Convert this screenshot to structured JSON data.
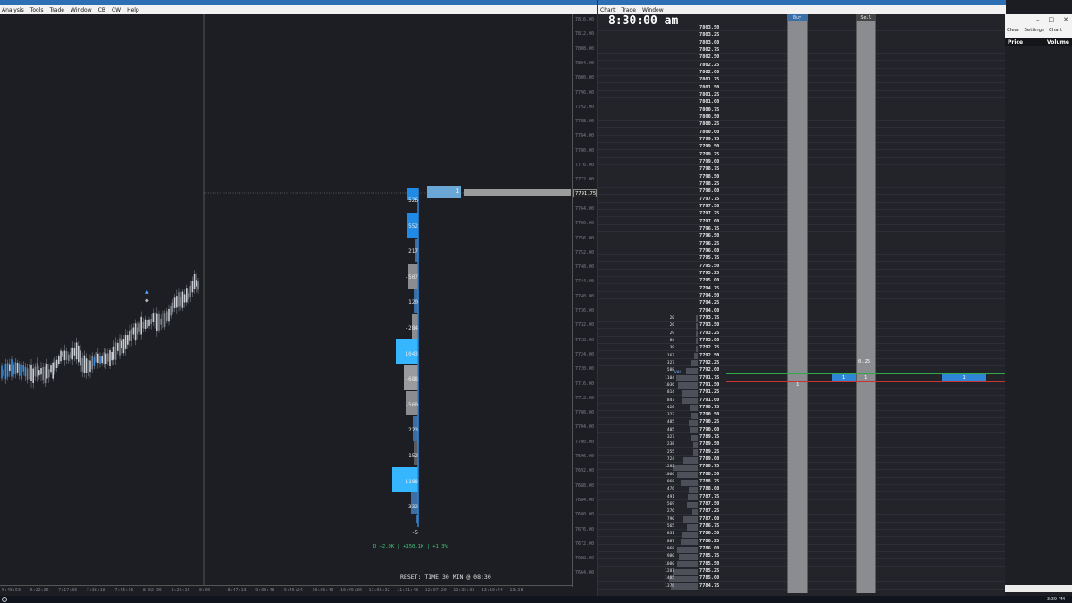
{
  "left_window": {
    "menu": [
      "Analysis",
      "Tools",
      "Trade",
      "Window",
      "CB",
      "CW",
      "Help"
    ],
    "price_axis_ticks": [
      "7816.00",
      "7812.00",
      "7808.00",
      "7804.00",
      "7800.00",
      "7796.00",
      "7792.00",
      "7788.00",
      "7784.00",
      "7780.00",
      "7776.00",
      "7772.00",
      "7768.00",
      "7764.00",
      "7760.00",
      "7756.00",
      "7752.00",
      "7748.00",
      "7744.00",
      "7740.00",
      "7736.00",
      "7732.00",
      "7728.00",
      "7724.00",
      "7720.00",
      "7716.00",
      "7712.00",
      "7708.00",
      "7704.00",
      "7700.00",
      "7696.00",
      "7692.00",
      "7688.00",
      "7684.00",
      "7680.00",
      "7676.00",
      "7672.00",
      "7668.00",
      "7664.00"
    ],
    "last_price": "7791.75",
    "time_axis_ticks": [
      "5:45:53",
      "6:22:26",
      "7:17:36",
      "7:38:18",
      "7:45:16",
      "8:02:35",
      "8:22:14",
      "8:30",
      "8:47:13",
      "9:03:48",
      "9:45:24",
      "10:06:40",
      "10:45:30",
      "11:08:32",
      "11:31:48",
      "12:07:20",
      "12:35:32",
      "13:10:44",
      "13:28"
    ],
    "delta_labels": [
      "526",
      "552",
      "217",
      "-507",
      "120",
      "-284",
      "1043",
      "-688",
      "-560",
      "223",
      "-152",
      "1188",
      "332",
      "-5"
    ],
    "summary": "D +2.0K | +150.1K | +1.3%",
    "reset_text": "RESET: TIME 30 MIN @ 08:30",
    "order_qty": "1"
  },
  "right_window": {
    "menu": [
      "Chart",
      "Trade",
      "Window"
    ],
    "clock": "8:30:00 am",
    "buy_header": "Buy",
    "sell_header": "Sell",
    "prices": [
      "7803.50",
      "7803.25",
      "7803.00",
      "7802.75",
      "7802.50",
      "7802.25",
      "7802.00",
      "7801.75",
      "7801.50",
      "7801.25",
      "7801.00",
      "7800.75",
      "7800.50",
      "7800.25",
      "7800.00",
      "7799.75",
      "7799.50",
      "7799.25",
      "7799.00",
      "7798.75",
      "7798.50",
      "7798.25",
      "7798.00",
      "7797.75",
      "7797.50",
      "7797.25",
      "7797.00",
      "7796.75",
      "7796.50",
      "7796.25",
      "7796.00",
      "7795.75",
      "7795.50",
      "7795.25",
      "7795.00",
      "7794.75",
      "7794.50",
      "7794.25",
      "7794.00",
      "7793.75",
      "7793.50",
      "7793.25",
      "7793.00",
      "7792.75",
      "7792.50",
      "7792.25",
      "7792.00",
      "7791.75",
      "7791.50",
      "7791.25",
      "7791.00",
      "7790.75",
      "7790.50",
      "7790.25",
      "7790.00",
      "7789.75",
      "7789.50",
      "7789.25",
      "7789.00",
      "7788.75",
      "7788.50",
      "7788.25",
      "7788.00",
      "7787.75",
      "7787.50",
      "7787.25",
      "7787.00",
      "7786.75",
      "7786.50",
      "7786.25",
      "7786.00",
      "7785.75",
      "7785.50",
      "7785.25",
      "7785.00",
      "7784.75"
    ],
    "volumes": [
      "20",
      "26",
      "29",
      "84",
      "39",
      "167",
      "327",
      "588",
      "1104",
      "1036",
      "814",
      "847",
      "420",
      "323",
      "485",
      "405",
      "327",
      "238",
      "255",
      "724",
      "1282",
      "1066",
      "868",
      "476",
      "491",
      "569",
      "276",
      "790",
      "565",
      "831",
      "887",
      "1068",
      "980",
      "1080",
      "1287",
      "1485",
      "1376"
    ],
    "val_label": "VAL",
    "buy_cell_value": "1",
    "sell_ask_value": "0.25",
    "bid_cells": [
      "1",
      "1"
    ],
    "right_cell": "1"
  },
  "side_panel": {
    "tabs": [
      "Clear",
      "Settings",
      "Chart"
    ],
    "header_price": "Price",
    "header_volume": "Volume"
  },
  "taskbar": {
    "time": "3:39 PM"
  }
}
